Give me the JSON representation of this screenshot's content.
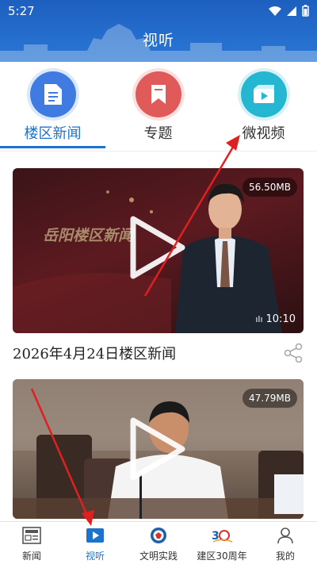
{
  "status_bar": {
    "time": "5:27"
  },
  "header": {
    "title": "视听"
  },
  "categories": [
    {
      "label": "楼区新闻",
      "icon": "document-icon",
      "color": "#3f7be0",
      "active": true
    },
    {
      "label": "专题",
      "icon": "bookmark-icon",
      "color": "#e05a5a",
      "active": false
    },
    {
      "label": "微视频",
      "icon": "video-icon",
      "color": "#25b6d2",
      "active": false
    }
  ],
  "videos": [
    {
      "title": "2026年4月24日楼区新闻",
      "size": "56.50MB",
      "duration": "10:10",
      "overlay_text": "岳阳楼区新闻"
    },
    {
      "title": "",
      "size": "47.79MB"
    }
  ],
  "bottom_nav": [
    {
      "label": "新闻",
      "icon": "newspaper-icon"
    },
    {
      "label": "视听",
      "icon": "play-square-icon",
      "active": true
    },
    {
      "label": "文明实践",
      "icon": "civilization-logo-icon"
    },
    {
      "label": "建区30周年",
      "icon": "anniversary-30-icon"
    },
    {
      "label": "我的",
      "icon": "user-icon"
    }
  ],
  "colors": {
    "accent": "#1d73cc",
    "header": "#2a78d6",
    "annotation": "#e02020"
  }
}
